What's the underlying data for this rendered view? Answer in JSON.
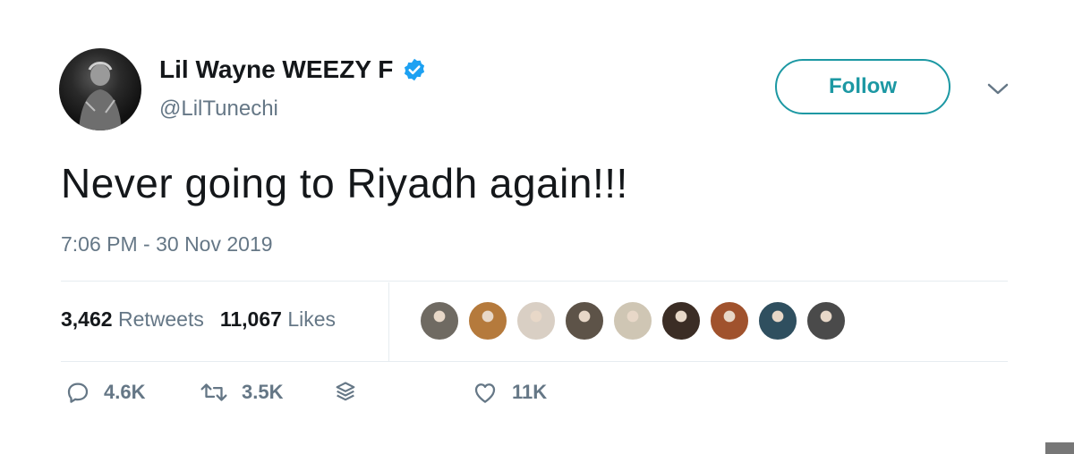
{
  "user": {
    "display_name": "Lil Wayne WEEZY F",
    "handle": "@LilTunechi",
    "verified": true,
    "avatar_icon": "profile-photo"
  },
  "follow": {
    "label": "Follow"
  },
  "tweet": {
    "text": "Never going to Riyadh again!!!",
    "timestamp": "7:06 PM - 30 Nov 2019"
  },
  "stats": {
    "retweets_count": "3,462",
    "retweets_label": "Retweets",
    "likes_count": "11,067",
    "likes_label": "Likes"
  },
  "likers": [
    {
      "icon": "liker-avatar",
      "color": "#6f6a62"
    },
    {
      "icon": "liker-avatar",
      "color": "#b57a3c"
    },
    {
      "icon": "liker-avatar",
      "color": "#d9cfc4"
    },
    {
      "icon": "liker-avatar",
      "color": "#5d5348"
    },
    {
      "icon": "liker-avatar",
      "color": "#cfc6b4"
    },
    {
      "icon": "liker-avatar",
      "color": "#3b2d25"
    },
    {
      "icon": "liker-avatar",
      "color": "#a0522d"
    },
    {
      "icon": "liker-avatar",
      "color": "#2f4f5f"
    },
    {
      "icon": "liker-avatar",
      "color": "#4a4a4a"
    }
  ],
  "actions": {
    "reply_count": "4.6K",
    "retweet_count": "3.5K",
    "like_count": "11K"
  },
  "colors": {
    "accent": "#1c98a3",
    "verified_badge": "#1da1f2",
    "secondary_text": "#657786",
    "divider": "#e6ecf0"
  }
}
